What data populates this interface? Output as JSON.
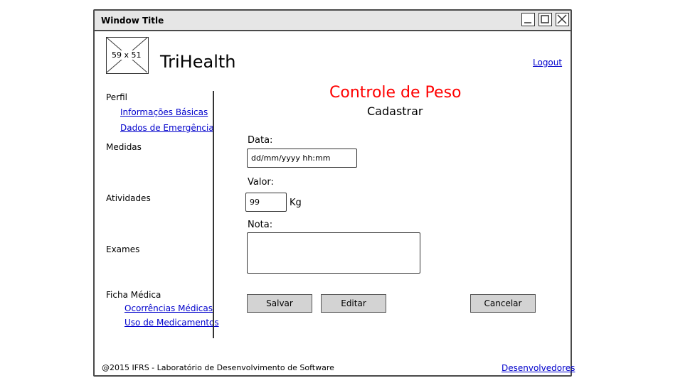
{
  "window": {
    "title": "Window Title"
  },
  "header": {
    "logo_placeholder": "59 x 51",
    "app_name": "TriHealth",
    "logout": "Logout"
  },
  "sidebar": {
    "perfil": "Perfil",
    "perfil_links": [
      "Informações Básicas",
      "Dados de Emergência"
    ],
    "medidas": "Medidas",
    "atividades": "Atividades",
    "exames": "Exames",
    "ficha": "Ficha Médica",
    "ficha_links": [
      "Ocorrências Médicas",
      "Uso de Medicamentos"
    ]
  },
  "main": {
    "title": "Controle de Peso",
    "subtitle": "Cadastrar",
    "data_label": "Data:",
    "data_value": "dd/mm/yyyy hh:mm",
    "valor_label": "Valor:",
    "valor_value": "99",
    "valor_unit": "Kg",
    "nota_label": "Nota:",
    "nota_value": "",
    "buttons": {
      "save": "Salvar",
      "edit": "Editar",
      "cancel": "Cancelar"
    }
  },
  "footer": {
    "copyright": "@2015 IFRS - Laboratório de Desenvolvimento de Software",
    "developers": "Desenvolvedores"
  },
  "colors": {
    "title_red": "#ff0000",
    "link_blue": "#0000cc",
    "button_gray": "#d3d3d3"
  }
}
